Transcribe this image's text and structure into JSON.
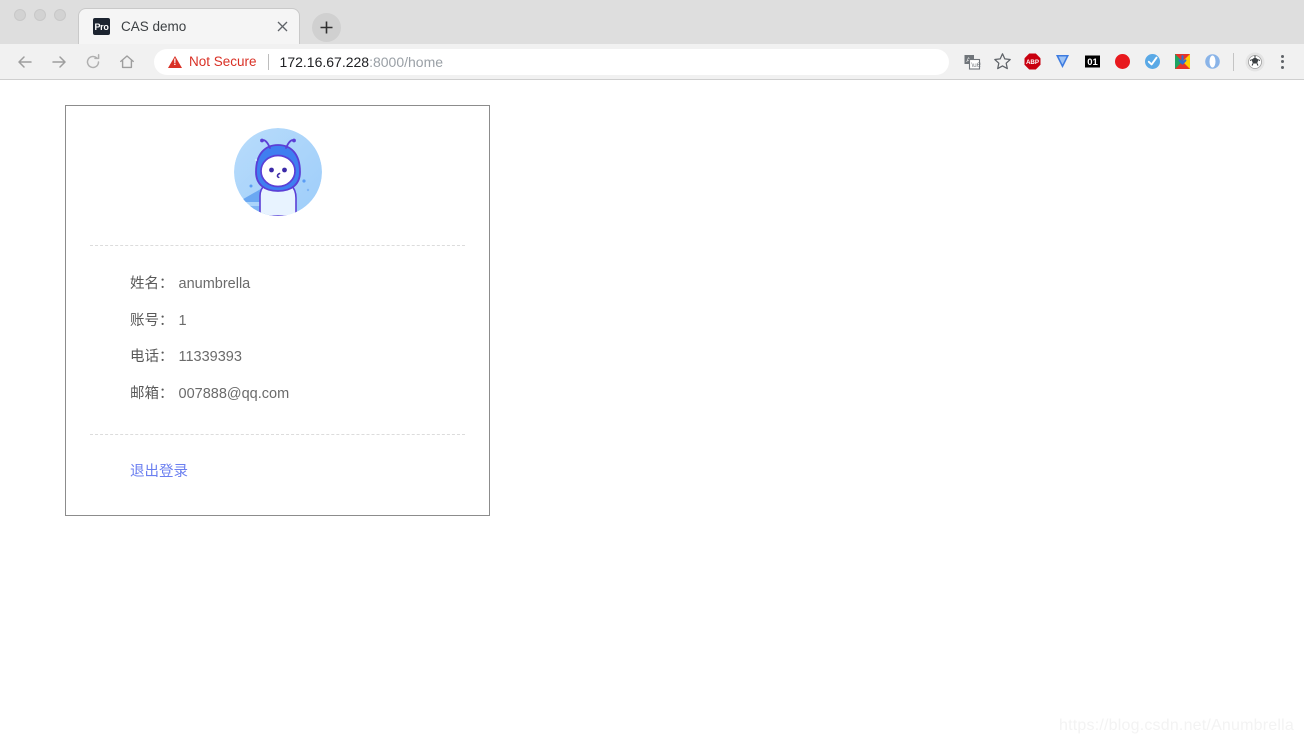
{
  "browser": {
    "window_controls": [
      "close",
      "minimize",
      "maximize"
    ],
    "tab": {
      "favicon_text": "Pro",
      "favicon_icon": "pro-favicon",
      "title": "CAS demo",
      "close_icon": "close-icon"
    },
    "new_tab_label": "+",
    "toolbar": {
      "back_icon": "back-arrow-icon",
      "forward_icon": "forward-arrow-icon",
      "reload_icon": "reload-icon",
      "home_icon": "home-icon",
      "security_label": "Not Secure",
      "security_color": "#d93025",
      "url_host": "172.16.67.228",
      "url_path": ":8000/home",
      "url_full": "172.16.67.228:8000/home",
      "translate_icon": "translate-icon",
      "bookmark_icon": "star-icon",
      "extensions": [
        {
          "name": "adblock-plus-extension-icon",
          "label": "ABP",
          "color": "#c9000f"
        },
        {
          "name": "vysor-extension-icon",
          "label": "",
          "color": "#3d7be0"
        },
        {
          "name": "zero-one-extension-icon",
          "label": "01",
          "color": "#000000"
        },
        {
          "name": "infinity-extension-icon",
          "label": "∞",
          "color": "#e8191e"
        },
        {
          "name": "check-circle-extension-icon",
          "label": "",
          "color": "#5aa9e6"
        },
        {
          "name": "chrome-download-extension-icon",
          "label": "",
          "color": "#1fa463"
        },
        {
          "name": "opera-ring-extension-icon",
          "label": "",
          "color": "#8ab4e8"
        }
      ],
      "profile_avatar_icon": "profile-avatar-icon",
      "menu_icon": "three-dot-menu-icon"
    }
  },
  "page": {
    "card": {
      "avatar_icon": "user-avatar-illustration",
      "info_rows": [
        {
          "label": "姓名：",
          "value": "anumbrella",
          "name": "name"
        },
        {
          "label": "账号：",
          "value": "1",
          "name": "account"
        },
        {
          "label": "电话：",
          "value": "11339393",
          "name": "phone"
        },
        {
          "label": "邮箱：",
          "value": "007888@qq.com",
          "name": "email"
        }
      ],
      "logout_label": "退出登录",
      "logout_color": "#6b7ff0"
    },
    "watermark": "https://blog.csdn.net/Anumbrella"
  }
}
